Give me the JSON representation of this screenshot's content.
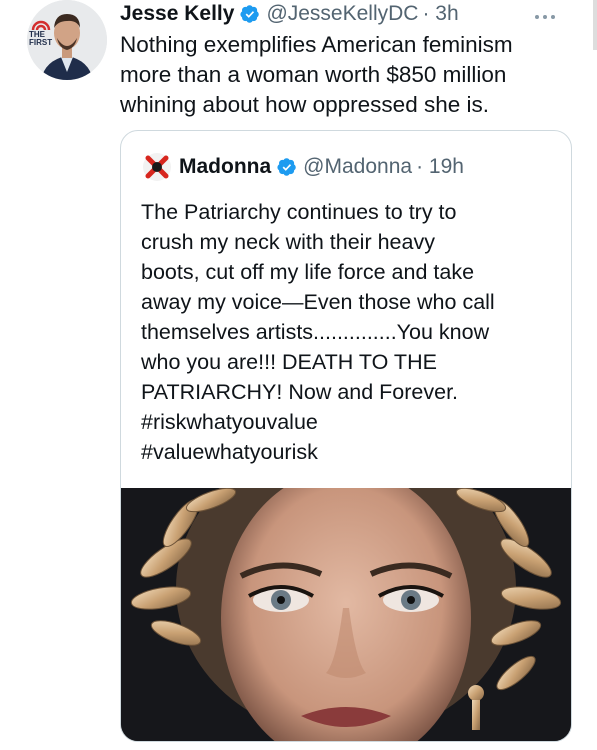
{
  "tweet": {
    "author_name": "Jesse Kelly",
    "handle": "@JesseKellyDC",
    "time": "· 3h",
    "text": "Nothing exemplifies American feminism more than a woman worth $850 million whining about how oppressed she is.",
    "avatar_badge": "THE FIRST"
  },
  "quoted": {
    "author_name": "Madonna",
    "handle": "@Madonna",
    "time": "· 19h",
    "lines": [
      "The Patriarchy continues to try to",
      "crush my neck with their heavy",
      "boots, cut off my life force and take",
      "away my voice—Even those who call",
      "themselves artists..............You know",
      "who you are!!! DEATH TO THE",
      "PATRIARCHY! Now and Forever.",
      "#riskwhatyouvalue",
      "#valuewhatyourisk"
    ]
  },
  "colors": {
    "verified": "#1d9bf0",
    "handle": "#536471",
    "border": "#cfd9de"
  }
}
